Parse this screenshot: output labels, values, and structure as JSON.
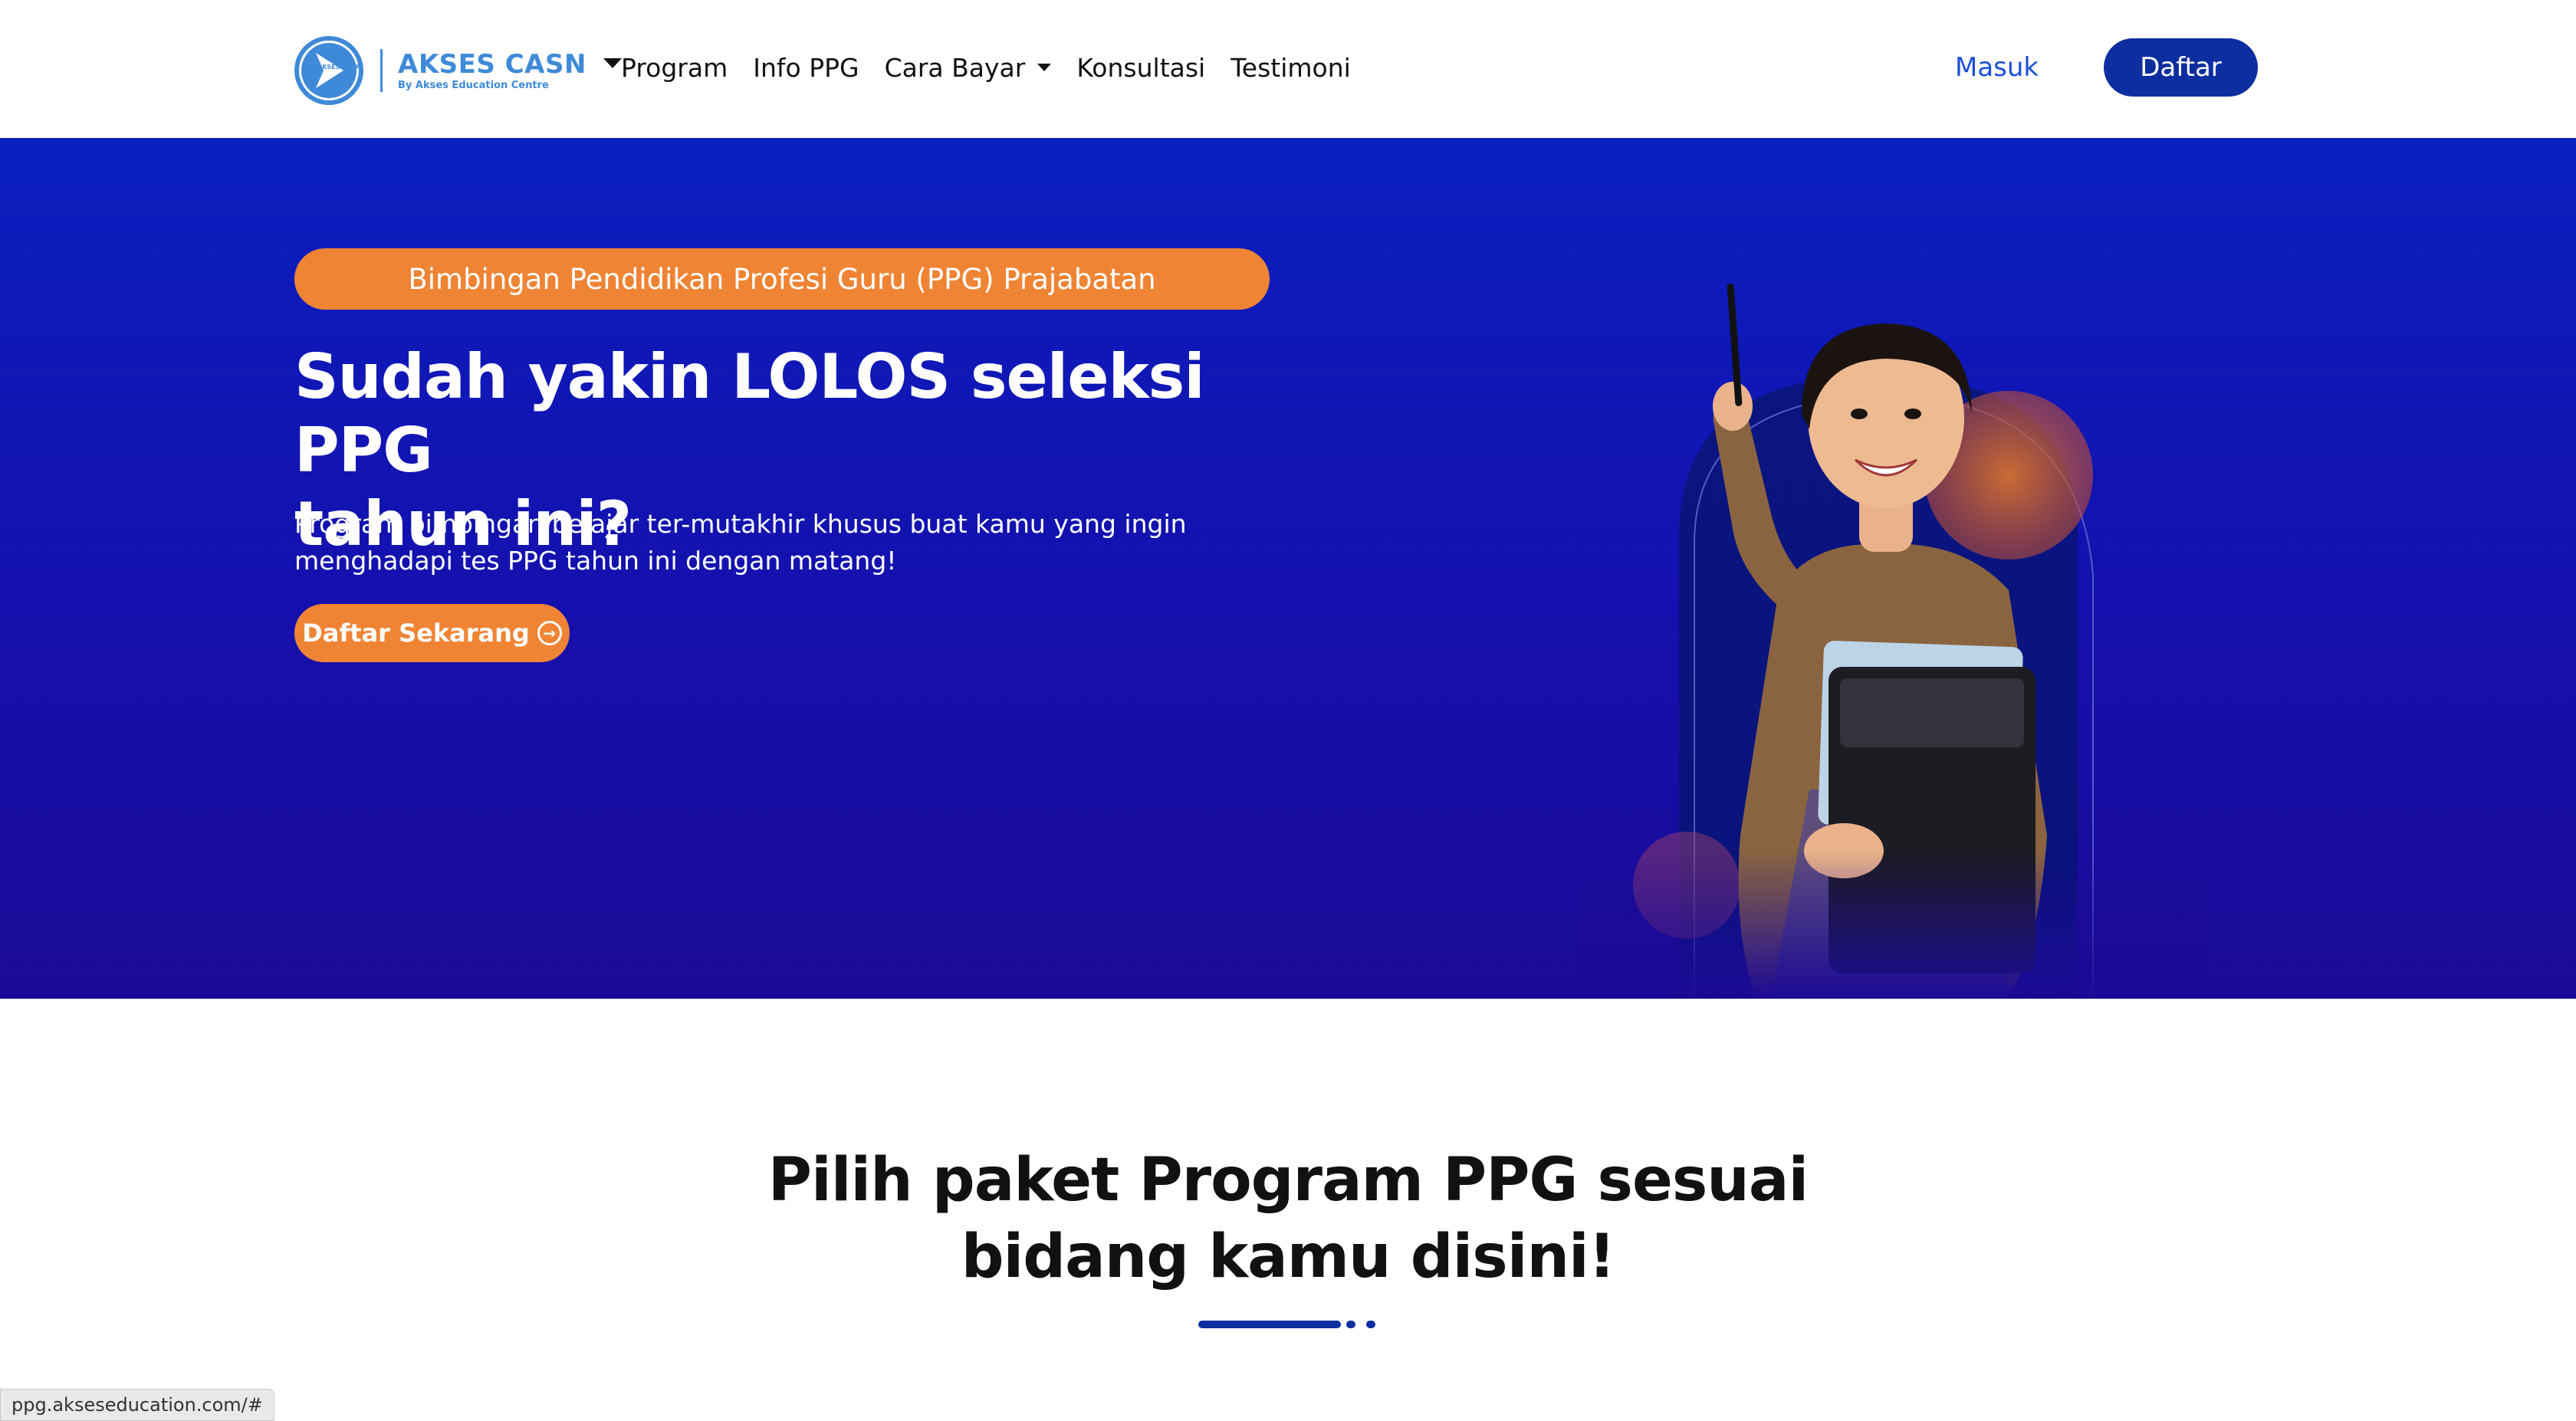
{
  "header": {
    "logo": {
      "title": "AKSES CASN",
      "subtitle": "By Akses Education Centre",
      "mark_text": "AKSES CASN"
    },
    "nav": [
      {
        "label": "Program",
        "has_dropdown": false
      },
      {
        "label": "Info PPG",
        "has_dropdown": false
      },
      {
        "label": "Cara Bayar",
        "has_dropdown": true
      },
      {
        "label": "Konsultasi",
        "has_dropdown": false
      },
      {
        "label": "Testimoni",
        "has_dropdown": false
      }
    ],
    "login_label": "Masuk",
    "register_label": "Daftar"
  },
  "hero": {
    "badge": "Bimbingan Pendidikan Profesi Guru (PPG) Prajabatan",
    "title_line1": "Sudah yakin LOLOS seleksi PPG",
    "title_line2": "tahun ini?",
    "desc_line1": "Program bimbingan belajar ter-mutakhir khusus buat kamu yang ingin",
    "desc_line2": "menghadapi tes PPG tahun ini dengan matang!",
    "cta_label": "Daftar Sekarang",
    "cta_icon": "arrow-circle-right-icon"
  },
  "section": {
    "title_line1": "Pilih paket Program PPG sesuai",
    "title_line2": "bidang kamu disini!"
  },
  "status_bar": {
    "url": "ppg.akseseducation.com/#"
  },
  "colors": {
    "primary": "#0d2ea0",
    "link": "#1a4fd6",
    "accent_orange": "#ef8434",
    "hero_top": "#0a1fbf",
    "hero_bottom": "#1c0a96",
    "logo_blue": "#3f8ad8"
  }
}
